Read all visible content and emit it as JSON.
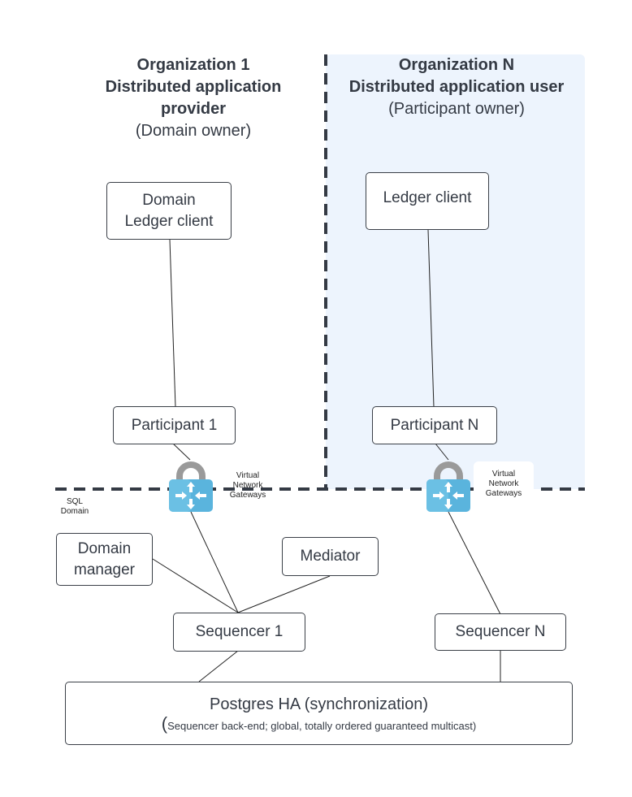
{
  "org1": {
    "title": "Organization 1",
    "subtitle_line1": "Distributed application",
    "subtitle_line2": "provider",
    "role": "(Domain owner)"
  },
  "orgN": {
    "title": "Organization N",
    "subtitle": "Distributed application user",
    "role": "(Participant owner)",
    "panel_color": "#edf4fd"
  },
  "nodes": {
    "domain_ledger_client_line1": "Domain",
    "domain_ledger_client_line2": "Ledger client",
    "ledger_client": "Ledger client",
    "participant_1": "Participant 1",
    "participant_n": "Participant N",
    "domain_manager_line1": "Domain",
    "domain_manager_line2": "manager",
    "mediator": "Mediator",
    "sequencer_1": "Sequencer 1",
    "sequencer_n": "Sequencer N",
    "postgres_title": "Postgres HA (synchronization)",
    "postgres_sub_paren": "(",
    "postgres_sub": "Sequencer back-end; global, totally ordered guaranteed multicast)"
  },
  "gateways": {
    "label_line1": "Virtual",
    "label_line2": "Network",
    "label_line3": "Gateways",
    "icon": "virtual-network-gateway-lock-icon"
  },
  "sql_domain": {
    "line1": "SQL",
    "line2": "Domain"
  },
  "colors": {
    "boundary": "#343a44",
    "gateway_blue": "#5ab4dd",
    "lock_gray": "#999999"
  }
}
